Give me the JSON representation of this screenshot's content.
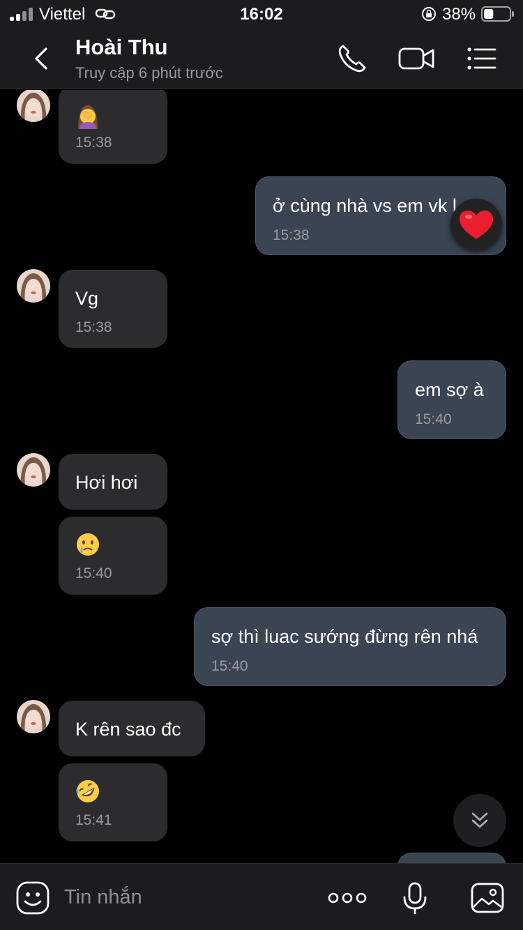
{
  "status_bar": {
    "carrier": "Viettel",
    "time": "16:02",
    "battery_percent": "38%",
    "battery_level": 0.38
  },
  "header": {
    "contact_name": "Hoài Thu",
    "contact_status": "Truy cập 6 phút trước",
    "icons": [
      "back-icon",
      "phone-icon",
      "video-camera-icon",
      "menu-list-icon"
    ]
  },
  "messages": [
    {
      "direction": "in",
      "emoji": "woman-facepalming",
      "time": "15:38"
    },
    {
      "direction": "out",
      "text": "ở cùng nhà vs em vk l",
      "time": "15:38",
      "reaction": "heart"
    },
    {
      "direction": "in",
      "text": "Vg",
      "time": "15:38"
    },
    {
      "direction": "out",
      "text": "em sợ à",
      "time": "15:40"
    },
    {
      "direction": "in",
      "text": "Hơi hơi",
      "time": ""
    },
    {
      "direction": "in",
      "emoji": "crying-face",
      "time": "15:40"
    },
    {
      "direction": "out",
      "text": "sợ thì luac sướng đừng rên nhá",
      "time": "15:40"
    },
    {
      "direction": "in",
      "text": "K rên sao đc",
      "time": ""
    },
    {
      "direction": "in",
      "emoji": "rolling-on-floor-laughing",
      "time": "15:41"
    }
  ],
  "composer": {
    "placeholder": "Tin nhắn",
    "icons": [
      "sticker-icon",
      "more-icon",
      "microphone-icon",
      "image-icon"
    ]
  },
  "colors": {
    "background": "#000000",
    "bar": "#1c1c1e",
    "incoming_bubble": "#2c2c2e",
    "outgoing_bubble": "#3a4453",
    "secondary_text": "#9a9a9e"
  }
}
